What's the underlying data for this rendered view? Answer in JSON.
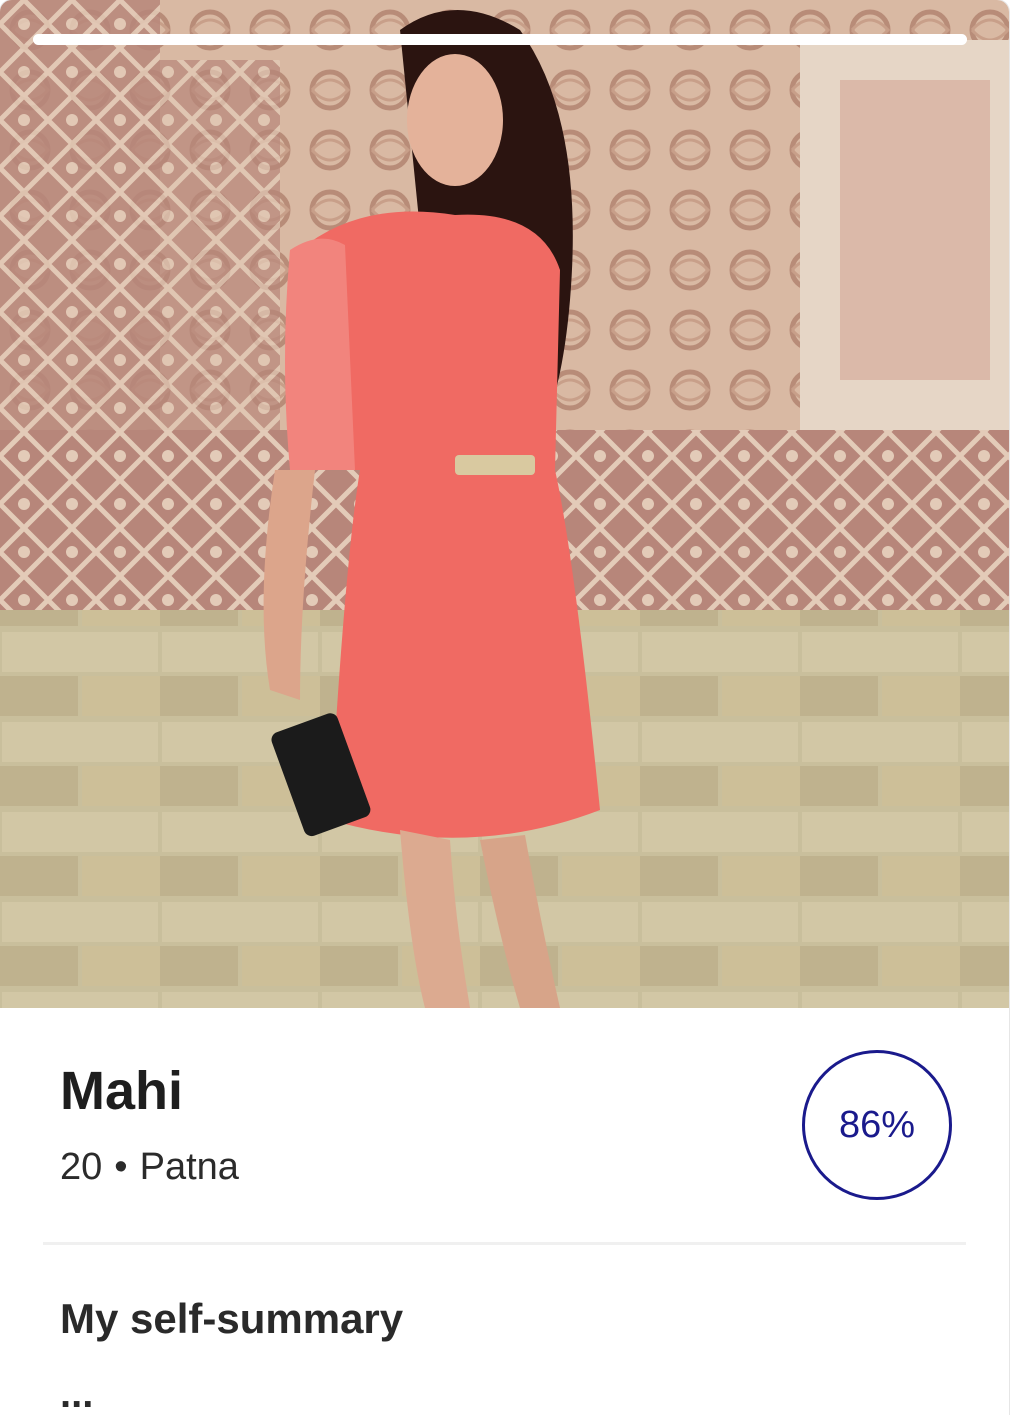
{
  "photo": {
    "icon": "profile-photo",
    "story_progress": 1.0
  },
  "profile": {
    "name": "Mahi",
    "age": "20",
    "separator": "•",
    "location": "Patna"
  },
  "match": {
    "percent": "86%",
    "color": "#1a1a8c"
  },
  "sections": {
    "self_summary_title": "My self-summary",
    "self_summary_text": "..."
  }
}
